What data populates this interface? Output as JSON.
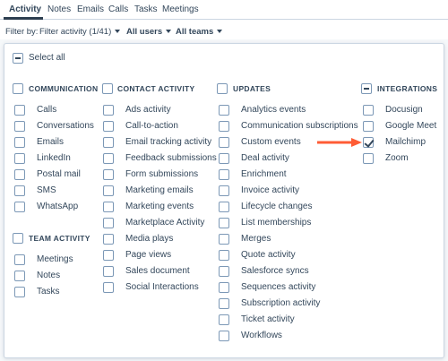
{
  "tabs": [
    "Activity",
    "Notes",
    "Emails",
    "Calls",
    "Tasks",
    "Meetings"
  ],
  "filters": {
    "filter_by_label": "Filter by:",
    "filter_activity": "Filter activity (1/41)",
    "users": "All users",
    "teams": "All teams"
  },
  "select_all": "Select all",
  "communication": {
    "header": "COMMUNICATION",
    "items": [
      "Calls",
      "Conversations",
      "Emails",
      "LinkedIn",
      "Postal mail",
      "SMS",
      "WhatsApp"
    ]
  },
  "team_activity": {
    "header": "TEAM ACTIVITY",
    "items": [
      "Meetings",
      "Notes",
      "Tasks"
    ]
  },
  "contact_activity": {
    "header": "CONTACT ACTIVITY",
    "items": [
      "Ads activity",
      "Call-to-action",
      "Email tracking activity",
      "Feedback submissions",
      "Form submissions",
      "Marketing emails",
      "Marketing events",
      "Marketplace Activity",
      "Media plays",
      "Page views",
      "Sales document",
      "Social Interactions"
    ]
  },
  "updates": {
    "header": "UPDATES",
    "items": [
      "Analytics events",
      "Communication subscriptions",
      "Custom events",
      "Deal activity",
      "Enrichment",
      "Invoice activity",
      "Lifecycle changes",
      "List memberships",
      "Merges",
      "Quote activity",
      "Salesforce syncs",
      "Sequences activity",
      "Subscription activity",
      "Ticket activity",
      "Workflows"
    ]
  },
  "integrations": {
    "header": "INTEGRATIONS",
    "items": [
      "Docusign",
      "Google Meet",
      "Mailchimp",
      "Zoom"
    ],
    "checked": [
      false,
      false,
      true,
      false
    ]
  },
  "colors": {
    "arrow": "#ff5c35",
    "text": "#33475b",
    "border": "#7c98b6"
  }
}
